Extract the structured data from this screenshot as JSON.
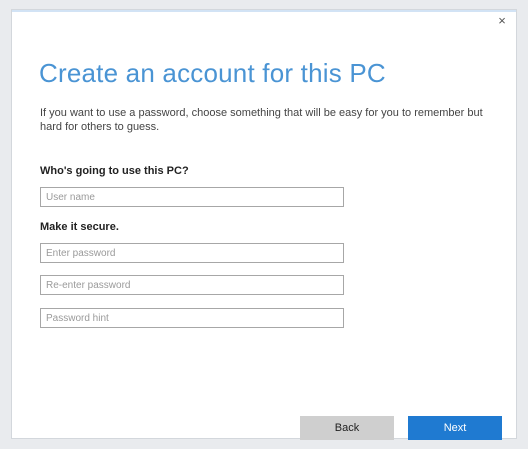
{
  "dialog": {
    "close_glyph": "×",
    "title": "Create an account for this PC",
    "description": "If you want to use a password, choose something that will be easy for you to remember but hard for others to guess.",
    "who_label": "Who's going to use this PC?",
    "secure_label": "Make it secure.",
    "fields": {
      "username": {
        "placeholder": "User name",
        "value": ""
      },
      "password": {
        "placeholder": "Enter password",
        "value": ""
      },
      "reenter": {
        "placeholder": "Re-enter password",
        "value": ""
      },
      "hint": {
        "placeholder": "Password hint",
        "value": ""
      }
    },
    "buttons": {
      "back_label": "Back",
      "next_label": "Next"
    }
  },
  "colors": {
    "accent": "#4a94d4",
    "primary_button": "#1f7ad1",
    "secondary_button": "#cfcfcf"
  }
}
